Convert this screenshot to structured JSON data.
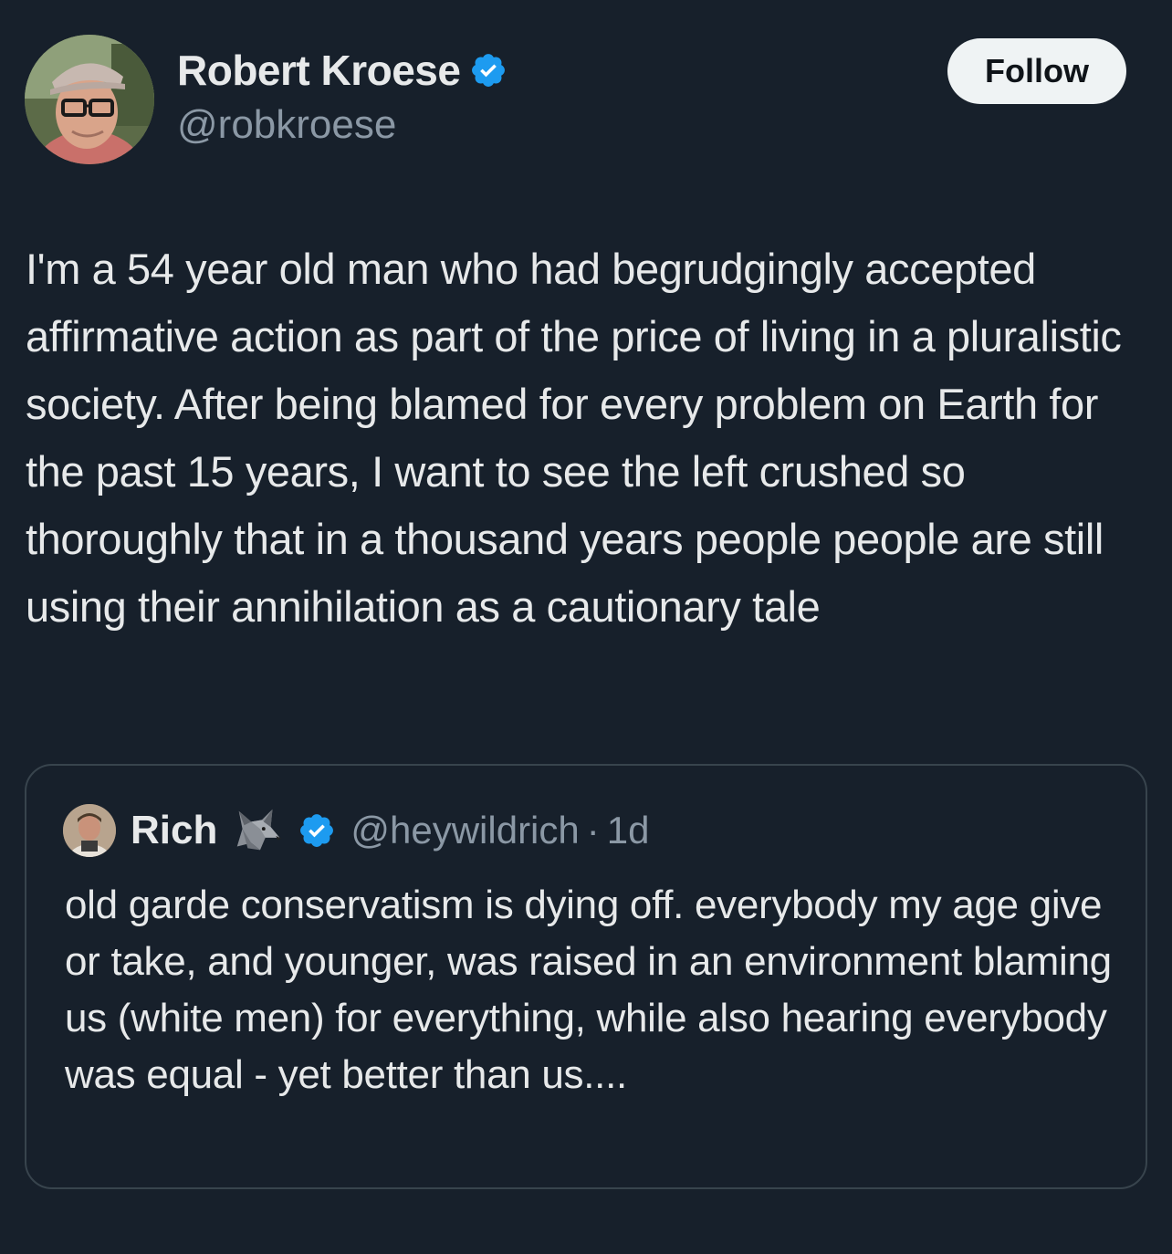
{
  "author": {
    "display_name": "Robert Kroese",
    "handle": "@robkroese",
    "verified_icon": "verified-badge-icon",
    "avatar_icon": "avatar"
  },
  "follow_button": {
    "label": "Follow"
  },
  "tweet": {
    "text": "I'm a 54 year old man who had begrudgingly accepted affirmative action as part of the price of living in a pluralistic society. After being blamed for every problem on Earth for the past 15 years, I want to see the left crushed so thoroughly that in a thousand years people people are still using their annihilation as a cautionary tale"
  },
  "quote": {
    "display_name": "Rich",
    "emoji_icon": "wolf-icon",
    "handle": "@heywildrich",
    "separator": "·",
    "time": "1d",
    "text": "old garde conservatism is dying off. everybody my age give or take, and younger, was raised in an environment blaming us (white men) for everything, while also hearing everybody was equal - yet better than us...."
  },
  "colors": {
    "background": "#17202b",
    "text_primary": "#e7e9ea",
    "text_secondary": "#8b98a5",
    "verified_blue": "#1d9bf0",
    "border": "#38444d",
    "follow_bg": "#eff3f4"
  }
}
